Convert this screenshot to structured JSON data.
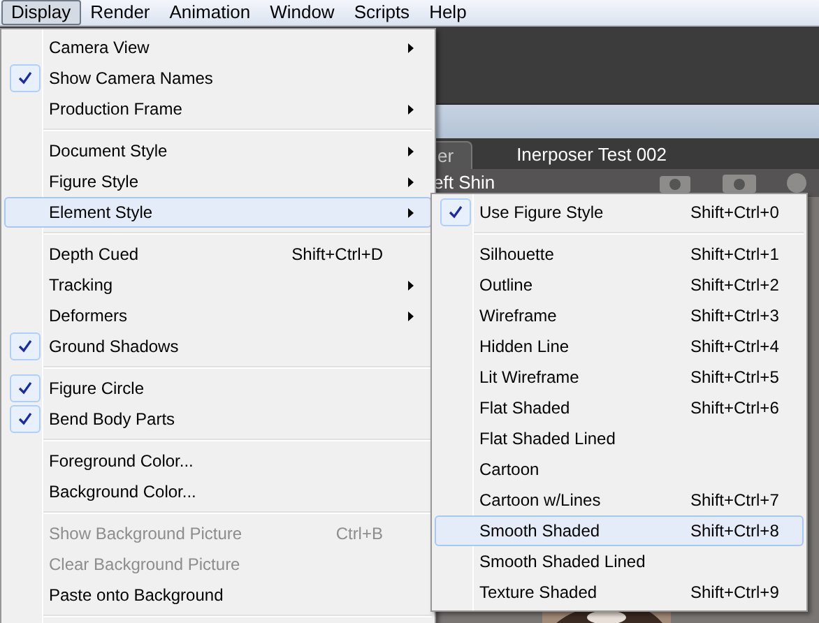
{
  "menubar": [
    {
      "label": "Display",
      "selected": true
    },
    {
      "label": "Render",
      "selected": false
    },
    {
      "label": "Animation",
      "selected": false
    },
    {
      "label": "Window",
      "selected": false
    },
    {
      "label": "Scripts",
      "selected": false
    },
    {
      "label": "Help",
      "selected": false
    }
  ],
  "document_tabs": [
    {
      "label": "er",
      "selected": false
    },
    {
      "label": "Inerposer Test 002",
      "selected": true
    }
  ],
  "actor_label": "eft Shin",
  "menu": [
    {
      "kind": "item",
      "label": "Camera View",
      "checked": false,
      "submenu": true,
      "highlighted": false,
      "disabled": false
    },
    {
      "kind": "item",
      "label": "Show Camera Names",
      "checked": true,
      "submenu": false,
      "highlighted": false,
      "disabled": false
    },
    {
      "kind": "item",
      "label": "Production Frame",
      "checked": false,
      "submenu": true,
      "highlighted": false,
      "disabled": false
    },
    {
      "kind": "separator"
    },
    {
      "kind": "item",
      "label": "Document Style",
      "checked": false,
      "submenu": true,
      "highlighted": false,
      "disabled": false
    },
    {
      "kind": "item",
      "label": "Figure Style",
      "checked": false,
      "submenu": true,
      "highlighted": false,
      "disabled": false
    },
    {
      "kind": "item",
      "label": "Element Style",
      "checked": false,
      "submenu": true,
      "highlighted": true,
      "disabled": false
    },
    {
      "kind": "separator"
    },
    {
      "kind": "item",
      "label": "Depth Cued",
      "shortcut": "Shift+Ctrl+D",
      "checked": false,
      "submenu": false,
      "highlighted": false,
      "disabled": false
    },
    {
      "kind": "item",
      "label": "Tracking",
      "checked": false,
      "submenu": true,
      "highlighted": false,
      "disabled": false
    },
    {
      "kind": "item",
      "label": "Deformers",
      "checked": false,
      "submenu": true,
      "highlighted": false,
      "disabled": false
    },
    {
      "kind": "item",
      "label": "Ground Shadows",
      "checked": true,
      "submenu": false,
      "highlighted": false,
      "disabled": false
    },
    {
      "kind": "separator"
    },
    {
      "kind": "item",
      "label": "Figure Circle",
      "checked": true,
      "submenu": false,
      "highlighted": false,
      "disabled": false
    },
    {
      "kind": "item",
      "label": "Bend Body Parts",
      "checked": true,
      "submenu": false,
      "highlighted": false,
      "disabled": false
    },
    {
      "kind": "separator"
    },
    {
      "kind": "item",
      "label": "Foreground Color...",
      "checked": false,
      "submenu": false,
      "highlighted": false,
      "disabled": false
    },
    {
      "kind": "item",
      "label": "Background Color...",
      "checked": false,
      "submenu": false,
      "highlighted": false,
      "disabled": false
    },
    {
      "kind": "separator"
    },
    {
      "kind": "item",
      "label": "Show Background Picture",
      "shortcut": "Ctrl+B",
      "checked": false,
      "submenu": false,
      "highlighted": false,
      "disabled": true
    },
    {
      "kind": "item",
      "label": "Clear Background Picture",
      "checked": false,
      "submenu": false,
      "highlighted": false,
      "disabled": true
    },
    {
      "kind": "item",
      "label": "Paste onto Background",
      "checked": false,
      "submenu": false,
      "highlighted": false,
      "disabled": false
    },
    {
      "kind": "separator"
    }
  ],
  "submenu": [
    {
      "kind": "item",
      "label": "Use Figure Style",
      "shortcut": "Shift+Ctrl+0",
      "checked": true,
      "highlighted": false
    },
    {
      "kind": "separator"
    },
    {
      "kind": "item",
      "label": "Silhouette",
      "shortcut": "Shift+Ctrl+1",
      "checked": false,
      "highlighted": false
    },
    {
      "kind": "item",
      "label": "Outline",
      "shortcut": "Shift+Ctrl+2",
      "checked": false,
      "highlighted": false
    },
    {
      "kind": "item",
      "label": "Wireframe",
      "shortcut": "Shift+Ctrl+3",
      "checked": false,
      "highlighted": false
    },
    {
      "kind": "item",
      "label": "Hidden Line",
      "shortcut": "Shift+Ctrl+4",
      "checked": false,
      "highlighted": false
    },
    {
      "kind": "item",
      "label": "Lit Wireframe",
      "shortcut": "Shift+Ctrl+5",
      "checked": false,
      "highlighted": false
    },
    {
      "kind": "item",
      "label": "Flat Shaded",
      "shortcut": "Shift+Ctrl+6",
      "checked": false,
      "highlighted": false
    },
    {
      "kind": "item",
      "label": "Flat Shaded Lined",
      "checked": false,
      "highlighted": false
    },
    {
      "kind": "item",
      "label": "Cartoon",
      "checked": false,
      "highlighted": false
    },
    {
      "kind": "item",
      "label": "Cartoon w/Lines",
      "shortcut": "Shift+Ctrl+7",
      "checked": false,
      "highlighted": false
    },
    {
      "kind": "item",
      "label": "Smooth Shaded",
      "shortcut": "Shift+Ctrl+8",
      "checked": false,
      "highlighted": true
    },
    {
      "kind": "item",
      "label": "Smooth Shaded Lined",
      "checked": false,
      "highlighted": false
    },
    {
      "kind": "item",
      "label": "Texture Shaded",
      "shortcut": "Shift+Ctrl+9",
      "checked": false,
      "highlighted": false
    }
  ]
}
